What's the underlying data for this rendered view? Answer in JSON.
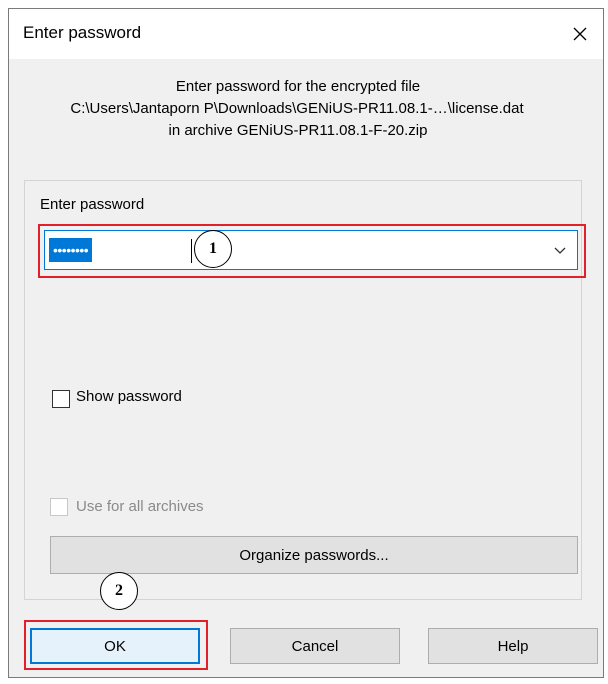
{
  "window": {
    "title": "Enter password"
  },
  "info": {
    "line1": "Enter password for the encrypted file",
    "line2": "C:\\Users\\Jantaporn P\\Downloads\\GENiUS-PR11.08.1-…\\license.dat",
    "line3": "in archive GENiUS-PR11.08.1-F-20.zip"
  },
  "password": {
    "label": "Enter password",
    "value": "••••••••"
  },
  "show_password": {
    "label": "Show password",
    "checked": false
  },
  "use_for_all": {
    "label": "Use for all archives",
    "checked": false,
    "disabled": true
  },
  "buttons": {
    "organize": "Organize passwords...",
    "ok": "OK",
    "cancel": "Cancel",
    "help": "Help"
  },
  "annotations": {
    "step1": "1",
    "step2": "2"
  },
  "colors": {
    "highlight": "#e0202a",
    "accent": "#0078d7",
    "dialog_bg": "#f0f0f0"
  },
  "icons": {
    "close": "close-icon",
    "dropdown": "chevron-down-icon"
  }
}
